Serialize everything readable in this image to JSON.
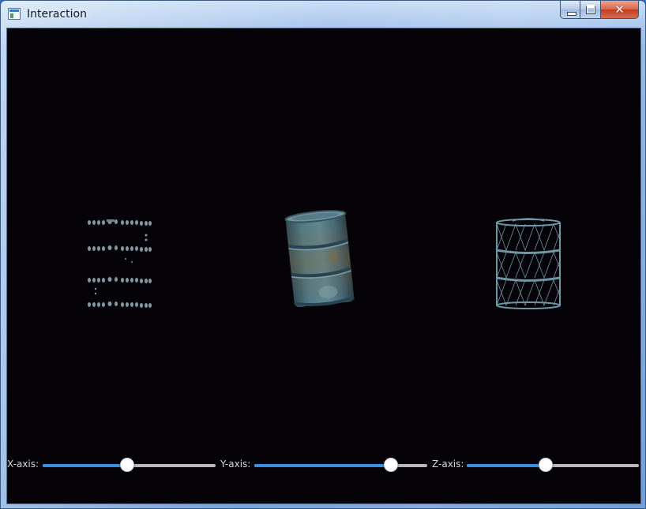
{
  "window": {
    "title": "Interaction",
    "close_glyph": "✕"
  },
  "icons": {
    "app": "app-window-icon",
    "minimize": "minimize-icon",
    "maximize": "maximize-icon",
    "close": "close-icon"
  },
  "scene": {
    "objects": [
      {
        "name": "barrel-point-cloud",
        "render_mode": "points"
      },
      {
        "name": "barrel-textured",
        "render_mode": "textured"
      },
      {
        "name": "barrel-wireframe",
        "render_mode": "wireframe"
      }
    ],
    "background_color": "#050307"
  },
  "controls": {
    "x_axis": {
      "label": "X-axis:",
      "value": 0.49
    },
    "y_axis": {
      "label": "Y-axis:",
      "value": 0.79
    },
    "z_axis": {
      "label": "Z-axis:",
      "value": 0.46
    }
  },
  "colors": {
    "accent": "#3b8ee0",
    "track": "#b9b9b9",
    "label_text": "#d8d8d8"
  }
}
